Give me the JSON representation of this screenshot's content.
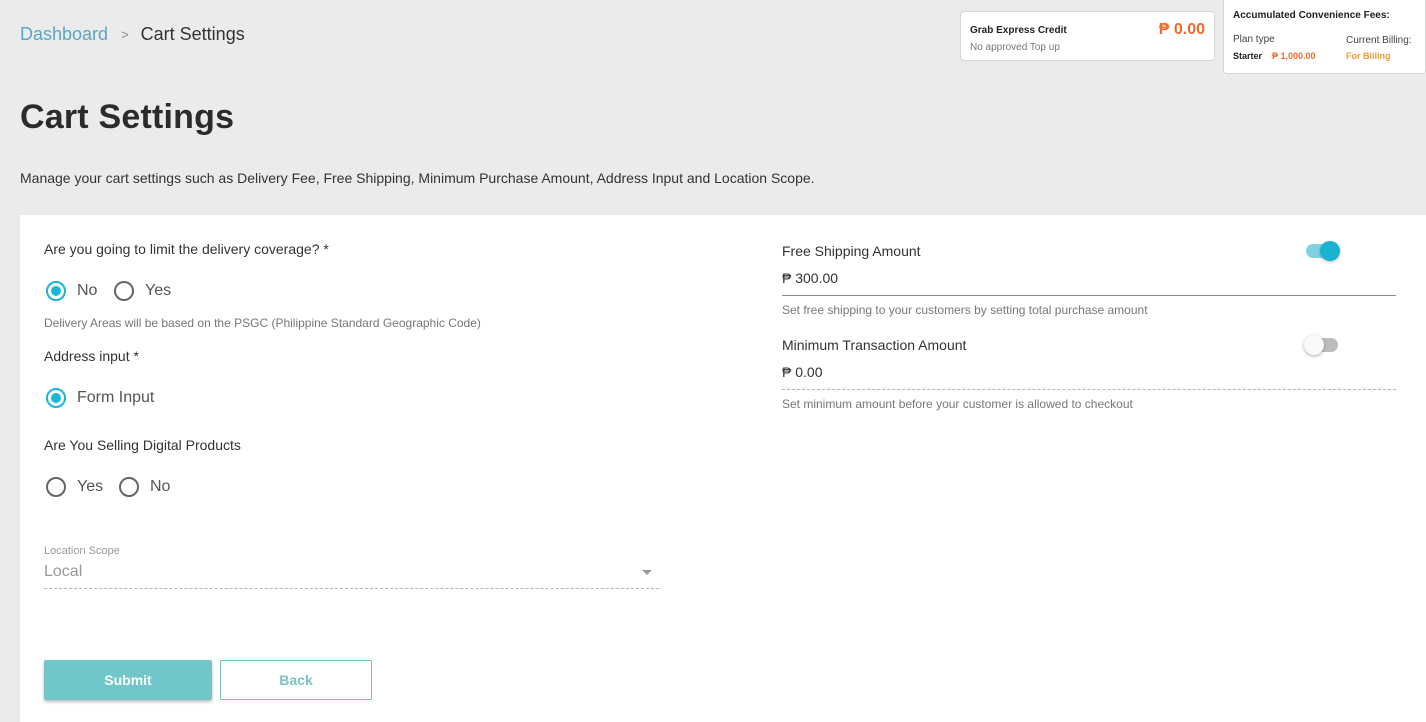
{
  "breadcrumb": {
    "root": "Dashboard",
    "separator": ">",
    "current": "Cart Settings"
  },
  "credit": {
    "title": "Grab Express Credit",
    "subtitle": "No approved Top up",
    "amount": "₱ 0.00"
  },
  "fees": {
    "title": "Accumulated Convenience Fees:",
    "plan_label": "Plan type",
    "plan": "Starter",
    "plan_amount": "₱ 1,000.00",
    "billing_label": "Current Billing:",
    "billing": "For Billing"
  },
  "page": {
    "title": "Cart Settings",
    "description": "Manage your cart settings such as Delivery Fee, Free Shipping, Minimum Purchase Amount, Address Input and Location Scope."
  },
  "coverage": {
    "question": "Are you going to limit the delivery coverage? *",
    "options": [
      {
        "label": "No",
        "checked": true
      },
      {
        "label": "Yes",
        "checked": false
      }
    ],
    "hint": "Delivery Areas will be based on the PSGC (Philippine Standard Geographic Code)"
  },
  "address": {
    "question": "Address input *",
    "options": [
      {
        "label": "Form Input",
        "checked": true
      }
    ]
  },
  "digital": {
    "question": "Are You Selling Digital Products",
    "options": [
      {
        "label": "Yes",
        "checked": false
      },
      {
        "label": "No",
        "checked": false
      }
    ]
  },
  "location": {
    "label": "Location Scope",
    "value": "Local"
  },
  "free_shipping": {
    "label": "Free Shipping Amount",
    "value": "₱ 300.00",
    "hint": "Set free shipping to your customers by setting total purchase amount",
    "enabled": true
  },
  "min_transaction": {
    "label": "Minimum Transaction Amount",
    "value": "₱ 0.00",
    "hint": "Set minimum amount before your customer is allowed to checkout",
    "enabled": false
  },
  "actions": {
    "submit": "Submit",
    "back": "Back"
  },
  "colors": {
    "accent": "#1bb6d3",
    "amount": "#ef6a2b",
    "billing": "#f39b3a",
    "submit": "#70c6c8",
    "link": "#5aa6c4"
  }
}
